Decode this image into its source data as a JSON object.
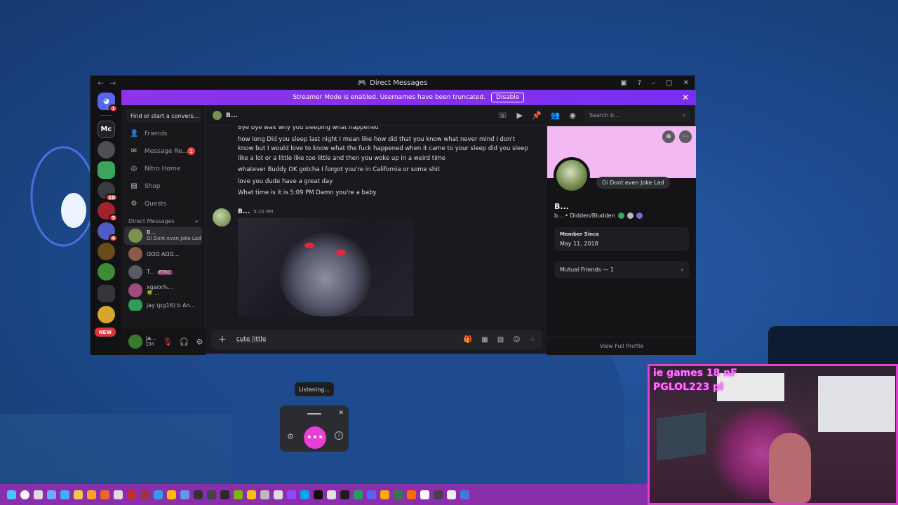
{
  "window": {
    "title": "Direct Messages",
    "nav_back": "←",
    "nav_fwd": "→"
  },
  "guilds": [
    {
      "label": "",
      "color": "#5865f2",
      "badge": "1"
    },
    {
      "label": "Mc",
      "color": "#202225",
      "badge": ""
    },
    {
      "label": "",
      "color": "#4d4f55",
      "badge": ""
    },
    {
      "label": "",
      "color": "#3ba55c",
      "badge": ""
    },
    {
      "label": "",
      "color": "#3a3b40",
      "badge": "10"
    },
    {
      "label": "",
      "color": "#a1232c",
      "badge": "3"
    },
    {
      "label": "",
      "color": "#4e5cc4",
      "badge": "4"
    },
    {
      "label": "",
      "color": "#6b4a1c",
      "badge": ""
    },
    {
      "label": "",
      "color": "#3c8d3a",
      "badge": ""
    },
    {
      "label": "",
      "color": "#35363b",
      "badge": ""
    }
  ],
  "guild_new": "NEW",
  "banner": {
    "text": "Streamer Mode is enabled. Usernames have been truncated.",
    "button": "Disable"
  },
  "dm_list": {
    "search_placeholder": "Find or start a convers...",
    "nav": [
      {
        "label": "Friends",
        "icon": "friends-icon",
        "badge": ""
      },
      {
        "label": "Message Re...",
        "icon": "message-requests-icon",
        "badge": "1"
      },
      {
        "label": "Nitro Home",
        "icon": "nitro-icon",
        "badge": ""
      },
      {
        "label": "Shop",
        "icon": "shop-icon",
        "badge": ""
      },
      {
        "label": "Quests",
        "icon": "quests-icon",
        "badge": ""
      }
    ],
    "header": "Direct Messages",
    "items": [
      {
        "name": "B...",
        "sub": "Oi Dont even Joke Lad",
        "tag": "",
        "color": "#7a9150"
      },
      {
        "name": "ꓷꓷꓷ ꓮꓷꓷ...",
        "sub": "",
        "tag": "",
        "color": "#8c5a4a"
      },
      {
        "name": "T...",
        "sub": "",
        "tag": "RTRO",
        "color": "#5a5b62"
      },
      {
        "name": "xgarx%...",
        "sub": "🍀 ...",
        "tag": "",
        "color": "#a04b7a"
      },
      {
        "name": "jay (pg16) b An...",
        "sub": "",
        "tag": "",
        "color": "#2f9e5a"
      }
    ]
  },
  "user": {
    "name": "ja...",
    "status": "DM"
  },
  "chat": {
    "recipient": "B...",
    "search_placeholder": "Search b...",
    "messages": [
      "Bye bye wait why you sleeping what happened",
      "how long Did you sleep last night I mean like how did that you know what never mind I don't know but I would love to know what the fuck happened when it came to your sleep did you sleep like a lot or a little like too little and then you woke up in a weird time",
      "whatever Buddy OK gotcha I forgot you're in California or some shit",
      "love you dude have a great day",
      "What time is it is 5:09 PM Damn you're a baby"
    ],
    "attach_author": "B...",
    "attach_time": "5:10 PM",
    "composer_value": "cute little"
  },
  "profile": {
    "status_bubble": "Oi Dont even Joke Lad",
    "name": "B...",
    "tag": "b... • Didden/Bludden",
    "member_since_label": "Member Since",
    "member_since": "May 11, 2018",
    "mutual_friends": "Mutual Friends — 1",
    "view_full": "View Full Profile"
  },
  "voice": {
    "tooltip": "Listening...",
    "mic_label": "•••"
  },
  "stream": {
    "overlay_line1": "ie games 18 nF",
    "overlay_line2": "PGLOL223 pl"
  },
  "colors": {
    "accent": "#5865f2",
    "banner": "#8e33e9",
    "voice": "#e93fd6",
    "taskbar": "#8a2fa9"
  }
}
